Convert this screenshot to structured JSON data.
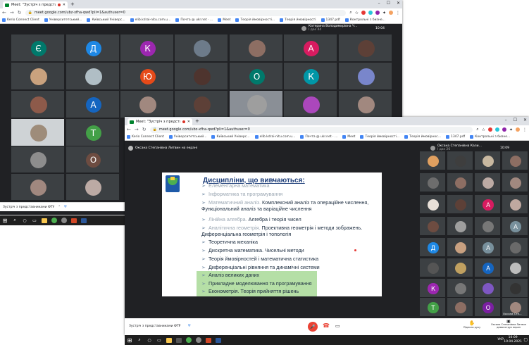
{
  "back_window": {
    "tab_title": "Meet: \"Зустріч з представн…",
    "url": "meet.google.com/ubz-xfha-qwd?pli=1&authuser=0",
    "bookmarks": [
      "Kerio Connect Client",
      "Університетський...",
      "Київський Універс...",
      "elib.kdrai-nitu.com.u...",
      "Почта @ ukr.net · ...",
      "Meet",
      "Теорія ймовірності...",
      "Теорія ймовірності",
      "1347.pdf",
      "Контрольні з бизне..."
    ],
    "presenter_name": "Катерина Володимирівна Ч...",
    "presenter_sub": "І дає 44",
    "clock": "10:04",
    "avatars": [
      {
        "letter": "Є",
        "color": "#00796b"
      },
      {
        "letter": "Д",
        "color": "#1e88e5"
      },
      {
        "letter": "К",
        "color": "#9c27b0"
      },
      {
        "letter": "А",
        "color": "#d81b60"
      },
      {
        "letter": "Ю",
        "color": "#e64a19"
      },
      {
        "letter": "О",
        "color": "#00796b"
      },
      {
        "letter": "К",
        "color": "#0097a7"
      },
      {
        "letter": "А",
        "color": "#1565c0"
      },
      {
        "letter": "Т",
        "color": "#43a047"
      },
      {
        "letter": "О",
        "color": "#6d4c41"
      }
    ],
    "taskbar_label": "Зустріч з представниками ФТУ"
  },
  "front_window": {
    "tab_title": "Meet: \"Зустріч з представн…",
    "url": "meet.google.com/ubz-xfha-qwd?pli=1&authuser=0",
    "bookmarks": [
      "Kerio Connect Client",
      "Університетський...",
      "Київський Універс...",
      "elib.kdrai-nitu.com.u...",
      "Почта @ ukr.net · ...",
      "Meet",
      "Теорія ймовірності...",
      "Теорія ймовірнос...",
      "1347.pdf",
      "Контрольні з бизне..."
    ],
    "presenter_banner": "Оксана Степанівна Литвин на екрані",
    "presenter_name": "Оксана Степанівна Кали...",
    "presenter_sub": "І дає 26",
    "clock": "10:09",
    "slide": {
      "title": "Дисципліни, що вивчаються:",
      "items": [
        {
          "text": "Елементарна математика",
          "style": "grey"
        },
        {
          "text": "Інформатика та програмування",
          "style": "grey"
        },
        {
          "text": "Математичний аналіз.",
          "rest": "Комплексний аналіз та операційне числення, Функціональний аналіз та варіаційне числення",
          "style": "mixed"
        },
        {
          "text": "Лінійна алгебра.",
          "rest": "Алгебра і теорія чисел",
          "style": "mixed"
        },
        {
          "text": "Аналітична геометрія.",
          "rest": "Проективна геометрія і методи зображень. Диференціальна геометрія і топологія",
          "style": "mixed"
        },
        {
          "text": "Теоретична механіка",
          "style": "dark"
        },
        {
          "text": "Дискретна математика. Чисельні методи",
          "style": "dark"
        },
        {
          "text": "Теорія ймовірностей і математична статистика",
          "style": "dark"
        },
        {
          "text": "Диференціальні рівняння та динамічні системи",
          "style": "dark"
        },
        {
          "text": "Аналіз великих даних",
          "style": "dark"
        },
        {
          "text": "Прикладне моделювання та програмування",
          "style": "dark"
        },
        {
          "text": "Економетрія. Теорія прийняття рішень",
          "style": "dark"
        }
      ]
    },
    "avatars": [
      {
        "letter": "А",
        "color": "#d81b60"
      },
      {
        "letter": "А",
        "color": "#78909c"
      },
      {
        "letter": "Д",
        "color": "#1e88e5"
      },
      {
        "letter": "А",
        "color": "#78909c"
      },
      {
        "letter": "А",
        "color": "#1565c0"
      },
      {
        "letter": "К",
        "color": "#9c27b0"
      },
      {
        "letter": "Т",
        "color": "#43a047"
      },
      {
        "letter": "О",
        "color": "#7b1fa2"
      }
    ],
    "last_tile_name": "Оксана Сте...",
    "bottom_bar": {
      "meeting_label": "Зустріч з представниками ФТУ",
      "raise_hand": "Підняти руку",
      "presenting": "Оксана Степанівна Литвин демонструє екран"
    },
    "taskbar": {
      "lang": "УКР",
      "time": "10:09",
      "date": "10.04.2021"
    }
  },
  "colors": {
    "accent": "#1a73e8",
    "meet_bg": "#202124",
    "slide_title": "#1f3f7a",
    "highlight": "#b5dfa6"
  }
}
